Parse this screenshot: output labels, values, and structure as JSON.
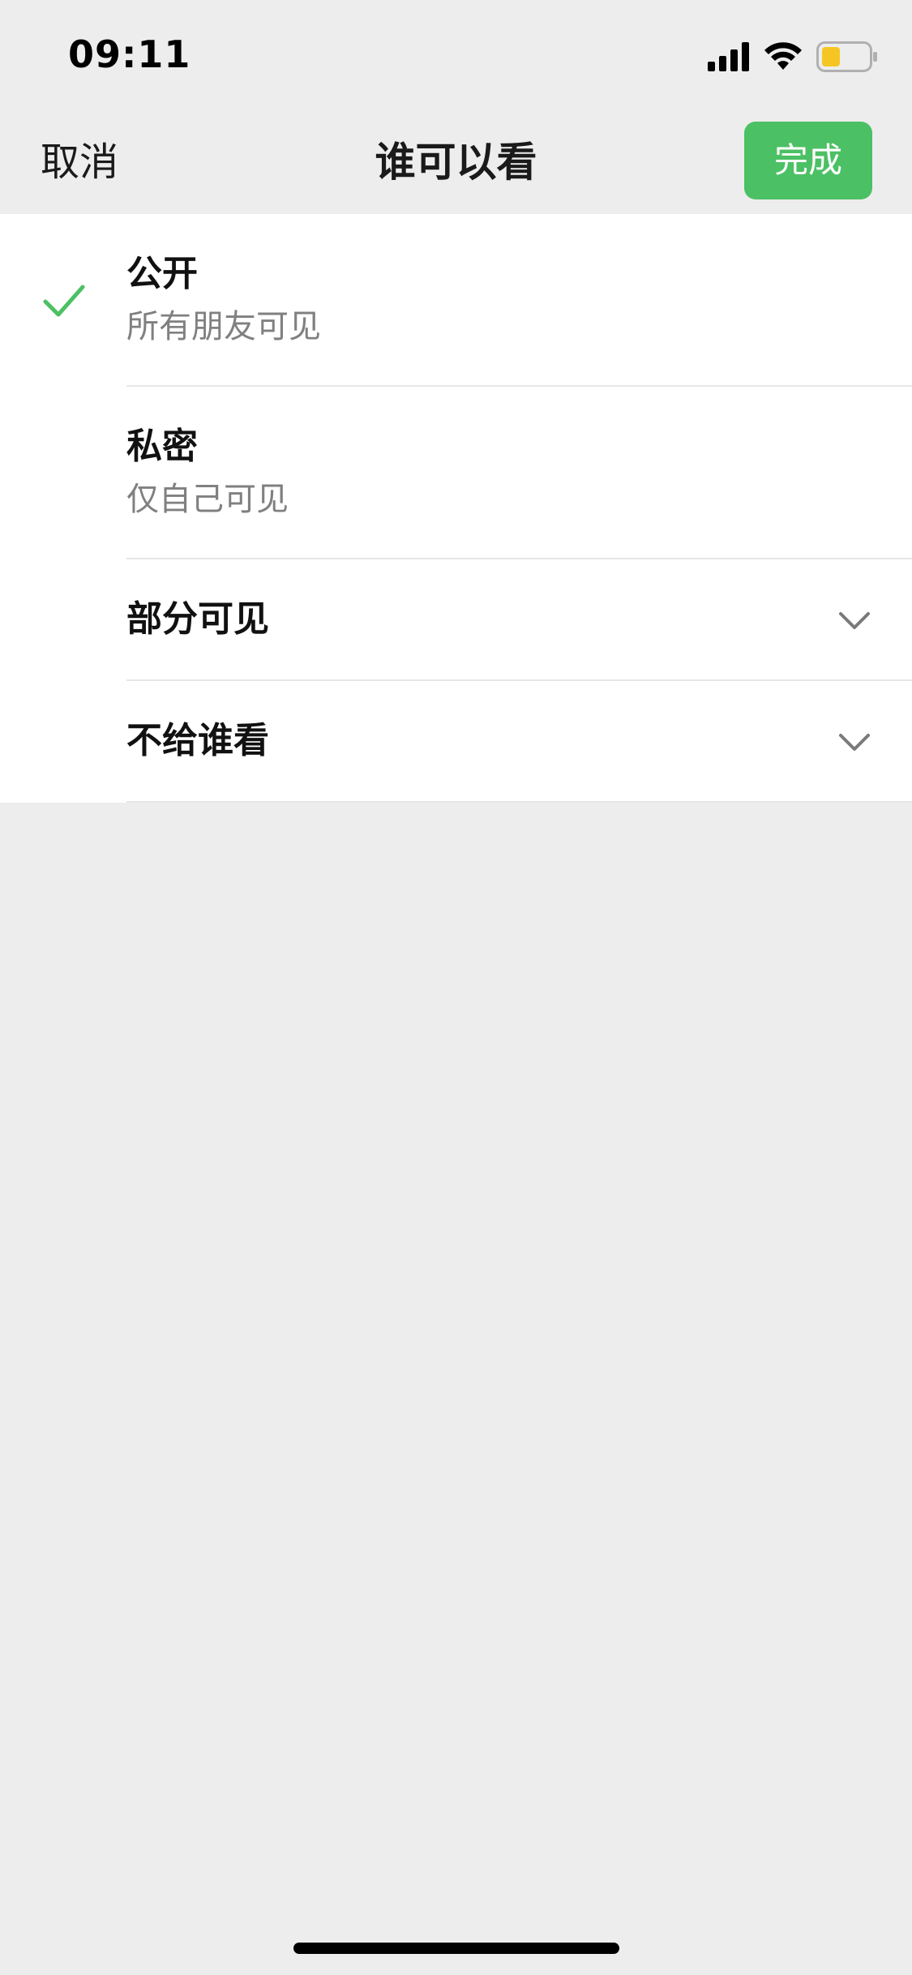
{
  "status_bar": {
    "time": "09:11",
    "icons": [
      "signal-icon",
      "wifi-icon",
      "battery-icon"
    ],
    "battery_color": "#f5c623"
  },
  "nav": {
    "cancel_label": "取消",
    "title": "谁可以看",
    "done_label": "完成",
    "done_color": "#4cc064"
  },
  "options": [
    {
      "title": "公开",
      "subtitle": "所有朋友可见",
      "selected": true,
      "icon": "check-icon"
    },
    {
      "title": "私密",
      "subtitle": "仅自己可见",
      "selected": false
    },
    {
      "title": "部分可见",
      "expandable": true,
      "icon": "chevron-down-icon"
    },
    {
      "title": "不给谁看",
      "expandable": true,
      "icon": "chevron-down-icon"
    }
  ],
  "colors": {
    "accent": "#4cc064",
    "background": "#ededed",
    "card": "#ffffff",
    "subtitle": "#808080"
  }
}
